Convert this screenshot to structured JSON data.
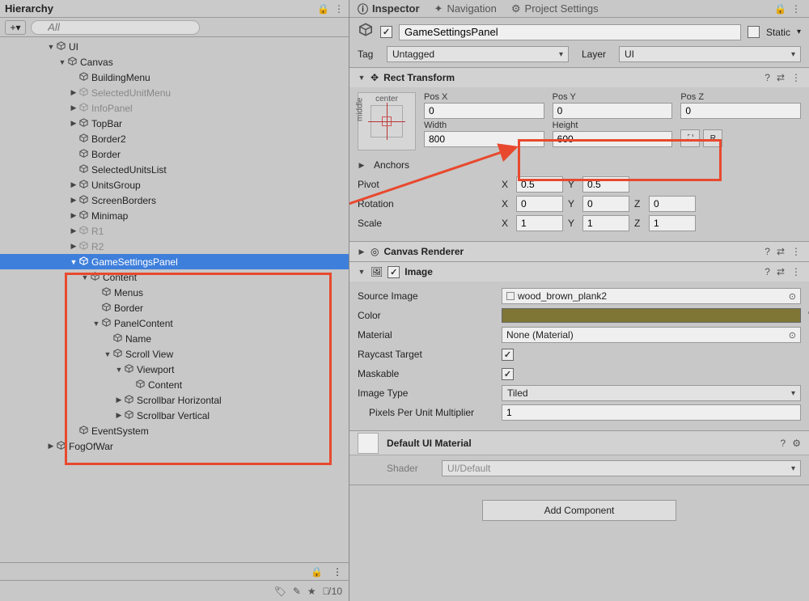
{
  "hierarchy": {
    "title": "Hierarchy",
    "search_placeholder": "All",
    "items": {
      "ui": "UI",
      "canvas": "Canvas",
      "building_menu": "BuildingMenu",
      "selected_unit_menu": "SelectedUnitMenu",
      "info_panel": "InfoPanel",
      "top_bar": "TopBar",
      "border2": "Border2",
      "border": "Border",
      "selected_units_list": "SelectedUnitsList",
      "units_group": "UnitsGroup",
      "screen_borders": "ScreenBorders",
      "minimap": "Minimap",
      "r1": "R1",
      "r2": "R2",
      "game_settings_panel": "GameSettingsPanel",
      "content": "Content",
      "menus": "Menus",
      "border_inner": "Border",
      "panel_content": "PanelContent",
      "name": "Name",
      "scroll_view": "Scroll View",
      "viewport": "Viewport",
      "content2": "Content",
      "scrollbar_h": "Scrollbar Horizontal",
      "scrollbar_v": "Scrollbar Vertical",
      "event_system": "EventSystem",
      "fog_of_war": "FogOfWar"
    },
    "footer_count": "10"
  },
  "inspector": {
    "tabs": {
      "inspector": "Inspector",
      "navigation": "Navigation",
      "project_settings": "Project Settings"
    },
    "go_name": "GameSettingsPanel",
    "static_label": "Static",
    "tag_label": "Tag",
    "tag_value": "Untagged",
    "layer_label": "Layer",
    "layer_value": "UI",
    "rect_transform": {
      "title": "Rect Transform",
      "anchor_top": "center",
      "anchor_left": "middle",
      "posx_label": "Pos X",
      "posx": "0",
      "posy_label": "Pos Y",
      "posy": "0",
      "posz_label": "Pos Z",
      "posz": "0",
      "width_label": "Width",
      "width": "800",
      "height_label": "Height",
      "height": "600",
      "anchors_label": "Anchors",
      "pivot_label": "Pivot",
      "pivot_x": "0.5",
      "pivot_y": "0.5",
      "rotation_label": "Rotation",
      "rot_x": "0",
      "rot_y": "0",
      "rot_z": "0",
      "scale_label": "Scale",
      "scale_x": "1",
      "scale_y": "1",
      "scale_z": "1",
      "blueprint_btn": "⛶",
      "raw_btn": "R"
    },
    "canvas_renderer": {
      "title": "Canvas Renderer"
    },
    "image": {
      "title": "Image",
      "source_label": "Source Image",
      "source_value": "wood_brown_plank2",
      "color_label": "Color",
      "material_label": "Material",
      "material_value": "None (Material)",
      "raycast_label": "Raycast Target",
      "maskable_label": "Maskable",
      "type_label": "Image Type",
      "type_value": "Tiled",
      "ppu_label": "Pixels Per Unit Multiplier",
      "ppu_value": "1"
    },
    "material": {
      "title": "Default UI Material",
      "shader_label": "Shader",
      "shader_value": "UI/Default"
    },
    "add_component": "Add Component",
    "xyz": {
      "x": "X",
      "y": "Y",
      "z": "Z"
    }
  }
}
